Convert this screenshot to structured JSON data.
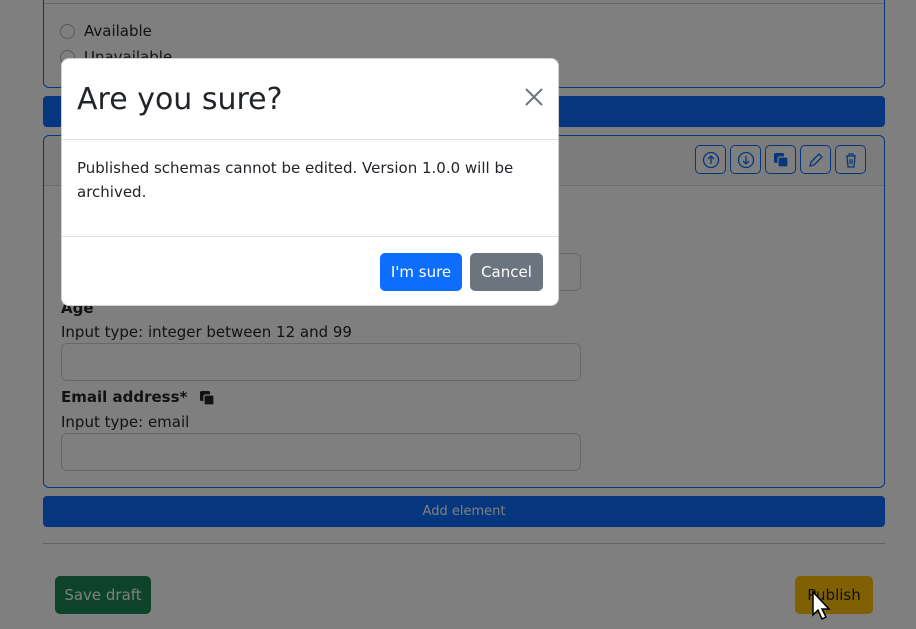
{
  "form": {
    "radio_options": [
      "Available",
      "Unavailable"
    ],
    "fields": [
      {
        "label": "Age",
        "type_text": "Input type: integer between 12 and 99"
      },
      {
        "label": "Email address*",
        "type_text": "Input type: email"
      }
    ],
    "add_element_label": "Add element",
    "toolbar_icons": [
      "arrow-up-circle-icon",
      "arrow-down-circle-icon",
      "copy-icon",
      "pencil-icon",
      "trash-icon"
    ]
  },
  "actions": {
    "save_draft_label": "Save draft",
    "publish_label": "Publish"
  },
  "modal": {
    "title": "Are you sure?",
    "body": "Published schemas cannot be edited. Version 1.0.0 will be archived.",
    "confirm_label": "I'm sure",
    "cancel_label": "Cancel"
  },
  "colors": {
    "primary": "#0d6efd",
    "success": "#198754",
    "warning": "#ffc107",
    "secondary": "#6c757d"
  }
}
